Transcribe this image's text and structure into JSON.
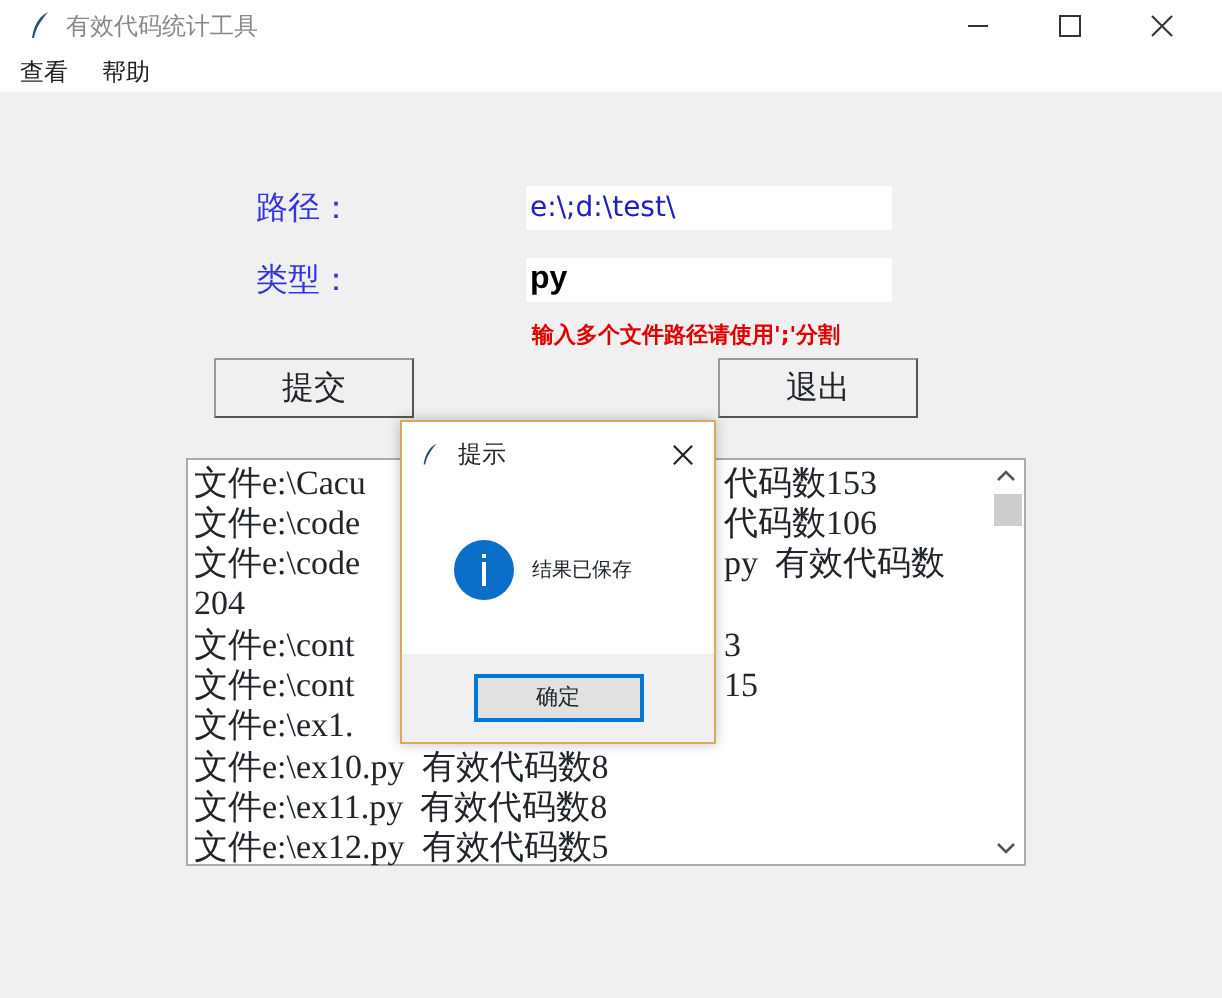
{
  "window": {
    "title": "有效代码统计工具"
  },
  "menu": [
    "查看",
    "帮助"
  ],
  "form": {
    "path_label": "路径：",
    "path_value": "e:\\;d:\\test\\",
    "type_label": "类型：",
    "type_value": "py",
    "hint": "输入多个文件路径请使用';'分割"
  },
  "buttons": [
    "提交",
    "退出"
  ],
  "output_lines": [
    {
      "text": "文件e:\\Cacu",
      "right_text": "代码数153"
    },
    {
      "text": "文件e:\\code",
      "right_text": "代码数106"
    },
    {
      "text": "文件e:\\code",
      "right_text": "py  有效代码数"
    },
    {
      "text": "204"
    },
    {
      "text": "文件e:\\cont",
      "right_text": "3"
    },
    {
      "text": "文件e:\\cont",
      "right_text": "15"
    },
    {
      "text": "文件e:\\ex1."
    },
    {
      "text": "文件e:\\ex10.py  有效代码数8"
    },
    {
      "text": "文件e:\\ex11.py  有效代码数8"
    },
    {
      "text": "文件e:\\ex12.py  有效代码数5"
    }
  ],
  "dialog": {
    "title": "提示",
    "message": "结果已保存",
    "button": "确定"
  }
}
